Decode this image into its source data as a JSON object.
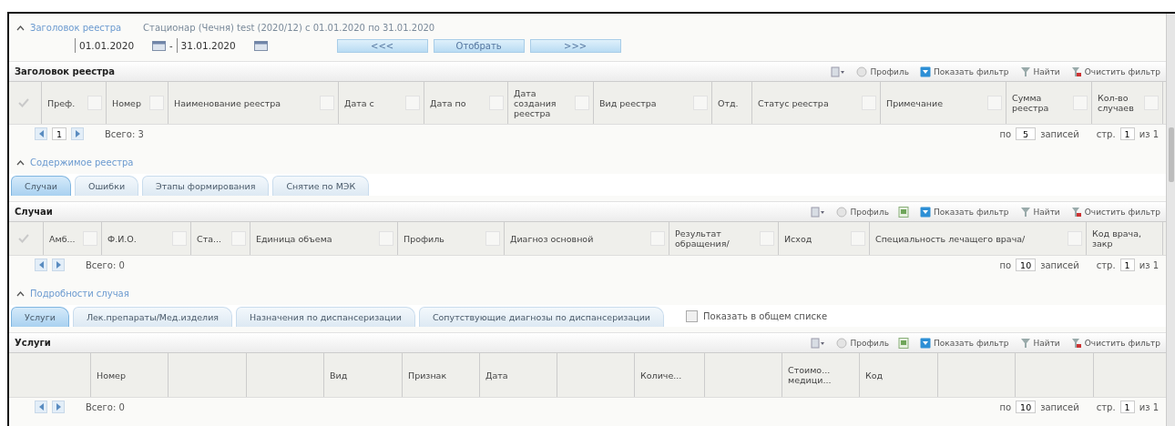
{
  "header": {
    "link": "Заголовок реестра",
    "expanded": true,
    "info": "Стационар (Чечня) test (2020/12) с 01.01.2020 по 31.01.2020",
    "date_from": "01.01.2020",
    "date_sep": "-",
    "date_to": "31.01.2020",
    "buttons": [
      "<<<",
      "Отобрать",
      ">>>"
    ]
  },
  "grid": {
    "title": "Заголовок реестра",
    "toolbar": [
      {
        "kind": "columns"
      },
      {
        "kind": "profile",
        "label": "Профиль"
      },
      {
        "kind": "filter",
        "label": "Показать фильтр"
      },
      {
        "kind": "find",
        "label": "Найти"
      },
      {
        "kind": "clear",
        "label": "Очистить фильтр"
      }
    ],
    "columns": [
      {
        "kind": "check"
      },
      {
        "kind": "text",
        "label": "Преф."
      },
      {
        "kind": "text",
        "label": "Номер"
      },
      {
        "kind": "text",
        "label": "Наименование реестра"
      },
      {
        "kind": "text",
        "label": "Дата с"
      },
      {
        "kind": "text",
        "label": "Дата по"
      },
      {
        "kind": "text",
        "label": "Дата создания реестра"
      },
      {
        "kind": "text",
        "label": "Вид реестра"
      },
      {
        "kind": "plain",
        "label": "Отд."
      },
      {
        "kind": "text",
        "label": "Статус реестра"
      },
      {
        "kind": "text",
        "label": "Примечание"
      },
      {
        "kind": "text",
        "label": "Сумма реестра"
      },
      {
        "kind": "text",
        "label": "Кол-во случаев"
      }
    ],
    "pager": {
      "page_input": "1",
      "total": "Всего: 3",
      "per_page_prefix": "по",
      "per_page": "5",
      "per_page_suffix": "записей",
      "page_prefix": "стр.",
      "page": "1",
      "page_of": "из 1"
    }
  },
  "sections": [
    {
      "title": "Содержимое реестра",
      "expanded": true,
      "tabs": [
        {
          "label": "Случаи",
          "selected": true
        },
        {
          "label": "Ошибки",
          "selected": false
        },
        {
          "label": "Этапы формирования",
          "selected": false
        },
        {
          "label": "Снятие по МЭК",
          "selected": false
        }
      ],
      "grid": {
        "title": "Случаи",
        "toolbar": [
          {
            "kind": "columns"
          },
          {
            "kind": "profile",
            "label": "Профиль"
          },
          {
            "kind": "excel"
          },
          {
            "kind": "filter",
            "label": "Показать фильтр"
          },
          {
            "kind": "find",
            "label": "Найти"
          },
          {
            "kind": "clear",
            "label": "Очистить фильтр"
          }
        ],
        "columns": [
          {
            "kind": "check"
          },
          {
            "kind": "text",
            "label": "Амб..."
          },
          {
            "kind": "text",
            "label": "Ф.И.О."
          },
          {
            "kind": "text",
            "label": "Ста..."
          },
          {
            "kind": "text",
            "label": "Единица объема"
          },
          {
            "kind": "text",
            "label": "Профиль"
          },
          {
            "kind": "text",
            "label": "Диагноз основной"
          },
          {
            "kind": "text",
            "label": "Результат обращения/"
          },
          {
            "kind": "text",
            "label": "Исход"
          },
          {
            "kind": "text",
            "label": "Специальность лечащего врача/"
          },
          {
            "kind": "plain",
            "label": "Код врача, закр"
          }
        ],
        "pager": {
          "total": "Всего: 0",
          "per_page_prefix": "по",
          "per_page": "10",
          "per_page_suffix": "записей",
          "page_prefix": "стр.",
          "page": "1",
          "page_of": "из 1"
        }
      }
    },
    {
      "title": "Подробности случая",
      "expanded": true,
      "tabs": [
        {
          "label": "Услуги",
          "selected": true
        },
        {
          "label": "Лек.препараты/Мед.изделия",
          "selected": false
        },
        {
          "label": "Назначения по диспансеризации",
          "selected": false
        },
        {
          "label": "Сопутствующие диагнозы по диспансеризации",
          "selected": false
        }
      ],
      "checkbox": {
        "label": "Показать в общем списке",
        "checked": false
      },
      "grid": {
        "title": "Услуги",
        "toolbar": [
          {
            "kind": "columns"
          },
          {
            "kind": "profile",
            "label": "Профиль"
          },
          {
            "kind": "excel"
          },
          {
            "kind": "filter",
            "label": "Показать фильтр"
          },
          {
            "kind": "find",
            "label": "Найти"
          },
          {
            "kind": "clear",
            "label": "Очистить фильтр"
          }
        ],
        "columns": [
          {
            "kind": "blank"
          },
          {
            "kind": "plain",
            "label": "Номер"
          },
          {
            "kind": "blank"
          },
          {
            "kind": "blank"
          },
          {
            "kind": "plain",
            "label": "Вид"
          },
          {
            "kind": "plain",
            "label": "Признак"
          },
          {
            "kind": "plain",
            "label": "Дата"
          },
          {
            "kind": "blank"
          },
          {
            "kind": "plain",
            "label": "Количе..."
          },
          {
            "kind": "blank"
          },
          {
            "kind": "plain",
            "label": "Стоимо... медици..."
          },
          {
            "kind": "plain",
            "label": "Код"
          },
          {
            "kind": "blank"
          },
          {
            "kind": "blank"
          },
          {
            "kind": "blank"
          }
        ],
        "pager": {
          "total": "Всего: 0",
          "per_page_prefix": "по",
          "per_page": "10",
          "per_page_suffix": "записей",
          "page_prefix": "стр.",
          "page": "1",
          "page_of": "из 1"
        }
      }
    }
  ]
}
